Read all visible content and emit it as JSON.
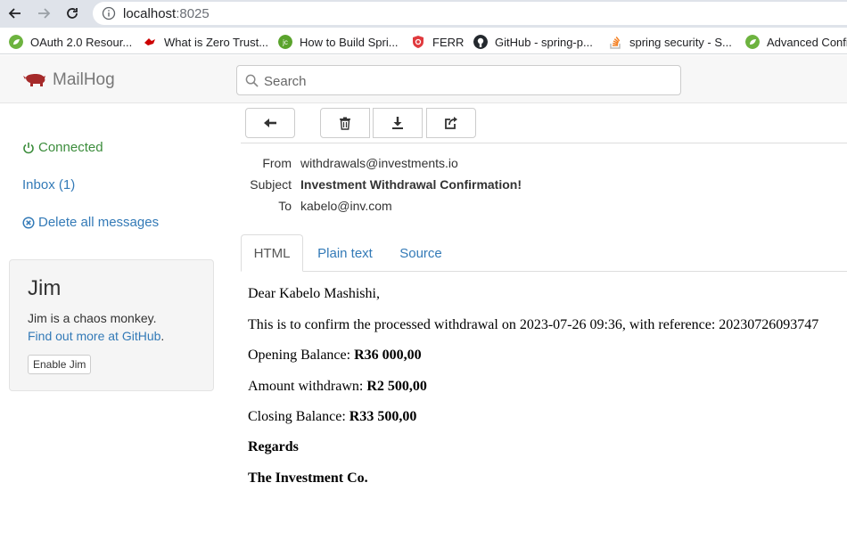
{
  "browser": {
    "url_host": "localhost",
    "url_port": ":8025",
    "bookmarks": [
      {
        "label": "OAuth 2.0 Resour...",
        "icon": "spring-leaf-icon",
        "color": "#6db33f"
      },
      {
        "label": "What is Zero Trust...",
        "icon": "redhat-icon",
        "color": "#cc0000"
      },
      {
        "label": "How to Build Spri...",
        "icon": "jcg-icon",
        "color": "#5aa32c"
      },
      {
        "label": "FERR",
        "icon": "shield-icon",
        "color": "#e03a3e"
      },
      {
        "label": "GitHub - spring-p...",
        "icon": "github-icon",
        "color": "#24292e"
      },
      {
        "label": "spring security - S...",
        "icon": "stackoverflow-icon",
        "color": "#f48024"
      },
      {
        "label": "Advanced Confi",
        "icon": "spring-leaf-icon",
        "color": "#6db33f"
      }
    ]
  },
  "app": {
    "brand": "MailHog",
    "search_placeholder": "Search"
  },
  "sidebar": {
    "connected": "Connected",
    "inbox": "Inbox (1)",
    "delete_all": "Delete all messages"
  },
  "jim": {
    "title": "Jim",
    "description": "Jim is a chaos monkey.",
    "link": "Find out more at GitHub",
    "link_suffix": ".",
    "button": "Enable Jim"
  },
  "headers": {
    "from_label": "From",
    "from": "withdrawals@investments.io",
    "subject_label": "Subject",
    "subject": "Investment Withdrawal Confirmation!",
    "to_label": "To",
    "to": "kabelo@inv.com"
  },
  "tabs": {
    "html": "HTML",
    "plain": "Plain text",
    "source": "Source"
  },
  "message": {
    "greeting": "Dear Kabelo Mashishi,",
    "confirmation": "This is to confirm the processed withdrawal on 2023-07-26 09:36, with reference: 20230726093747",
    "opening_label": "Opening Balance: ",
    "opening_value": "R36 000,00",
    "amount_label": "Amount withdrawn: ",
    "amount_value": "R2 500,00",
    "closing_label": "Closing Balance: ",
    "closing_value": "R33 500,00",
    "regards": "Regards",
    "signature": "The Investment Co."
  },
  "colors": {
    "link": "#337ab7",
    "connected": "#3c8d3c",
    "brand_pig": "#a52a2a"
  }
}
